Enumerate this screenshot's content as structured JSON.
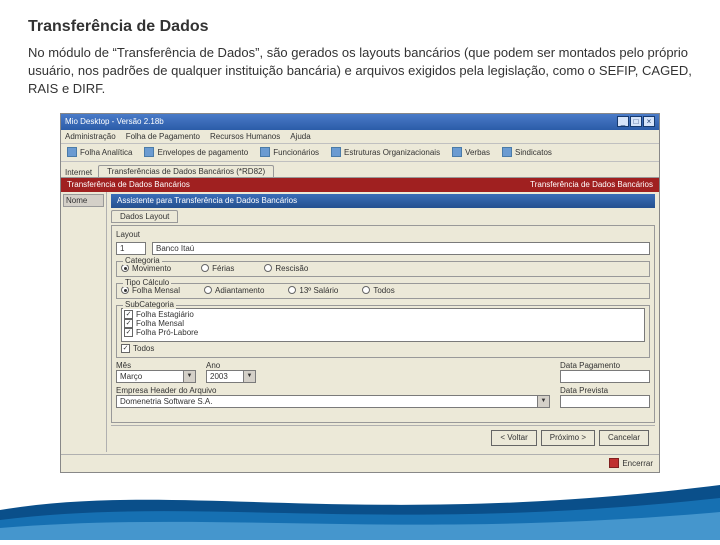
{
  "slide": {
    "title": "Transferência de Dados",
    "paragraph": "No módulo de “Transferência de Dados”, são gerados os layouts bancários (que podem ser montados pelo próprio usuário, nos padrões de qualquer instituição bancária) e arquivos exigidos pela legislação, como o SEFIP, CAGED, RAIS e DIRF."
  },
  "window": {
    "title": "Mio Desktop - Versão 2.18b",
    "menus": [
      "Administração",
      "Folha de Pagamento",
      "Recursos Humanos",
      "Ajuda"
    ],
    "wincontrols": {
      "min": "_",
      "max": "□",
      "close": "×"
    },
    "toolbar": [
      {
        "label": "Folha Analítica"
      },
      {
        "label": "Envelopes de pagamento"
      },
      {
        "label": "Funcionários"
      },
      {
        "label": "Estruturas Organizacionais"
      },
      {
        "label": "Verbas"
      },
      {
        "label": "Sindicatos"
      }
    ],
    "tabstrip": {
      "prefix": "Internet",
      "active": "Transferências de Dados Bancários (*RD82)"
    },
    "redbar": {
      "left": "Transferência de Dados Bancários",
      "right": "Transferência de Dados Bancários"
    }
  },
  "left": {
    "header": "Nome"
  },
  "wizard": {
    "title": "Assistente para Transferência de Dados Bancários",
    "tab": "Dados Layout",
    "layout": {
      "label": "Layout",
      "id": "1",
      "desc": "Banco Itaú"
    },
    "categoria": {
      "label": "Categoria",
      "options": [
        "Movimento",
        "Férias",
        "Rescisão"
      ],
      "selected": 0
    },
    "tipocalc": {
      "label": "Tipo Cálculo",
      "options": [
        "Folha Mensal",
        "Adiantamento",
        "13º Salário",
        "Todos"
      ],
      "selected": 0
    },
    "subcat": {
      "label": "SubCategoria",
      "items": [
        "Folha Estagiário",
        "Folha Mensal",
        "Folha Pró-Labore"
      ],
      "all": "Todos",
      "all_checked": true
    },
    "periodo": {
      "mes_label": "Mês",
      "mes": "Março",
      "ano_label": "Ano",
      "ano": "2003",
      "datapag_label": "Data Pagamento",
      "datapag": ""
    },
    "empresa": {
      "label": "Empresa Header do Arquivo",
      "value": "Domenetria Software S.A.",
      "dataprev_label": "Data Prevista",
      "dataprev": ""
    },
    "buttons": {
      "voltar": "< Voltar",
      "proximo": "Próximo >",
      "cancelar": "Cancelar"
    }
  },
  "statusbar": {
    "encerrar": "Encerrar"
  }
}
